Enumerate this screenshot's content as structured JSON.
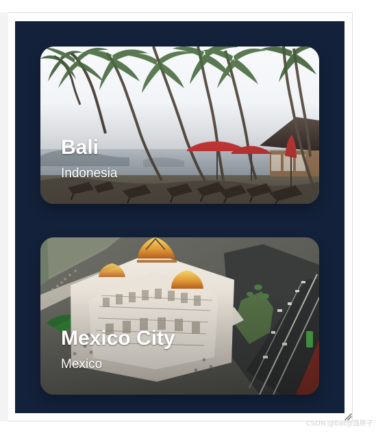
{
  "cards": [
    {
      "title": "Bali",
      "subtitle": "Indonesia",
      "image_subject": "tropical-beach-palm-trees"
    },
    {
      "title": "Mexico City",
      "subtitle": "Mexico",
      "image_subject": "palacio-de-bellas-artes-aerial"
    }
  ],
  "watermark": "CSDN @bat@饿胖子",
  "icons": {
    "resize_handle": "resize-handle-icon"
  },
  "colors": {
    "panel_background": "#13213a",
    "text": "#ffffff",
    "page_background": "#ffffff"
  }
}
